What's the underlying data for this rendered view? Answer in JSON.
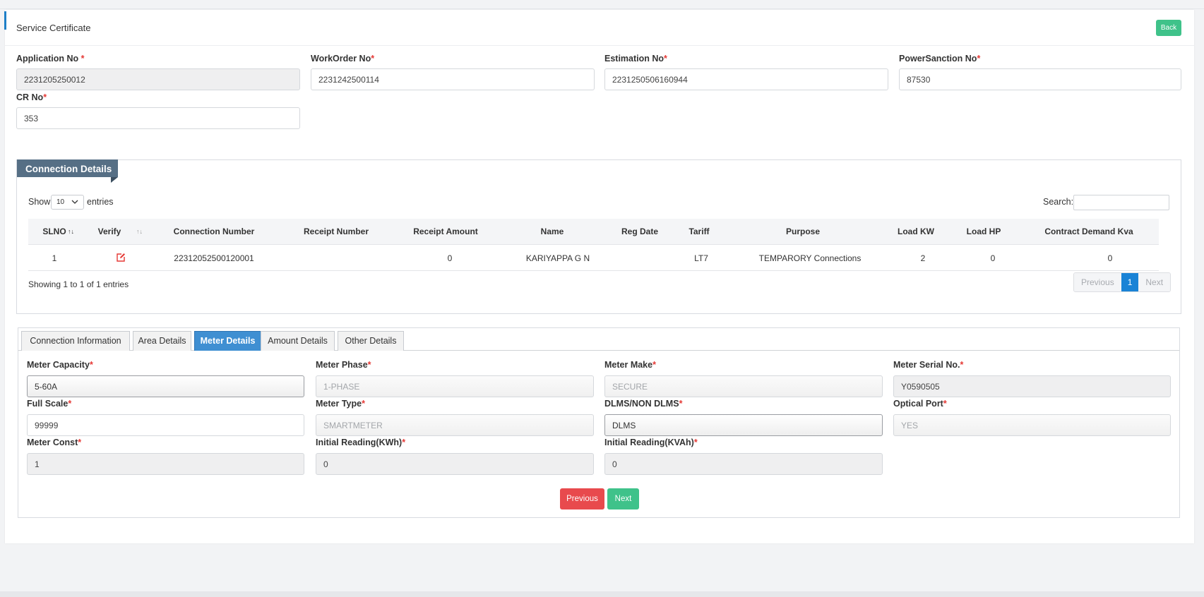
{
  "header": {
    "title": "Service Certificate",
    "back_label": "Back"
  },
  "required_mark": "*",
  "top_fields": {
    "application_no": {
      "label": "Application No ",
      "value": "2231205250012"
    },
    "workorder_no": {
      "label": "WorkOrder No",
      "value": "2231242500114"
    },
    "estimation_no": {
      "label": "Estimation No",
      "value": "2231250506160944"
    },
    "powersanction_no": {
      "label": "PowerSanction No",
      "value": "87530"
    },
    "cr_no": {
      "label": "CR No",
      "value": "353"
    }
  },
  "connection_details": {
    "title": "Connection Details",
    "show_label": "Show",
    "entries_value": "10",
    "entries_label": "entries",
    "search_label": "Search:",
    "columns": [
      "SLNO",
      "Verify",
      "Connection Number",
      "Receipt Number",
      "Receipt Amount",
      "Name",
      "Reg Date",
      "Tariff",
      "Purpose",
      "Load KW",
      "Load HP",
      "Contract Demand Kva"
    ],
    "rows": [
      {
        "slno": "1",
        "connection_number": "22312052500120001",
        "receipt_number": "",
        "receipt_amount": "0",
        "name": "KARIYAPPA G N",
        "reg_date": "",
        "tariff": "LT7",
        "purpose": "TEMPARORY Connections",
        "load_kw": "2",
        "load_hp": "0",
        "contract_demand": "0"
      }
    ],
    "info": "Showing 1 to 1 of 1 entries",
    "pager": {
      "previous": "Previous",
      "current": "1",
      "next": "Next"
    }
  },
  "tabs": [
    "Connection Information",
    "Area Details",
    "Meter Details",
    "Amount Details",
    "Other Details"
  ],
  "active_tab": "Meter Details",
  "meter": {
    "capacity": {
      "label": "Meter Capacity",
      "value": "5-60A"
    },
    "phase": {
      "label": "Meter Phase",
      "value": "1-PHASE"
    },
    "make": {
      "label": "Meter Make",
      "value": "SECURE"
    },
    "serial": {
      "label": "Meter Serial No.",
      "value": "Y0590505"
    },
    "full_scale": {
      "label": "Full Scale",
      "value": "99999"
    },
    "type": {
      "label": "Meter Type",
      "value": "SMARTMETER"
    },
    "dlms": {
      "label": "DLMS/NON DLMS",
      "value": "DLMS"
    },
    "optical": {
      "label": "Optical Port",
      "value": "YES"
    },
    "const": {
      "label": "Meter Const",
      "value": "1"
    },
    "initial_kwh": {
      "label": "Initial Reading(KWh)",
      "value": "0"
    },
    "initial_kvah": {
      "label": "Initial Reading(KVAh)",
      "value": "0"
    }
  },
  "actions": {
    "previous": "Previous",
    "next": "Next"
  },
  "colors": {
    "accent": "#1f7fc7",
    "success": "#3fc28a",
    "danger": "#e84a4d",
    "ribbon": "#566f85",
    "tab_active": "#3f8fd2"
  }
}
